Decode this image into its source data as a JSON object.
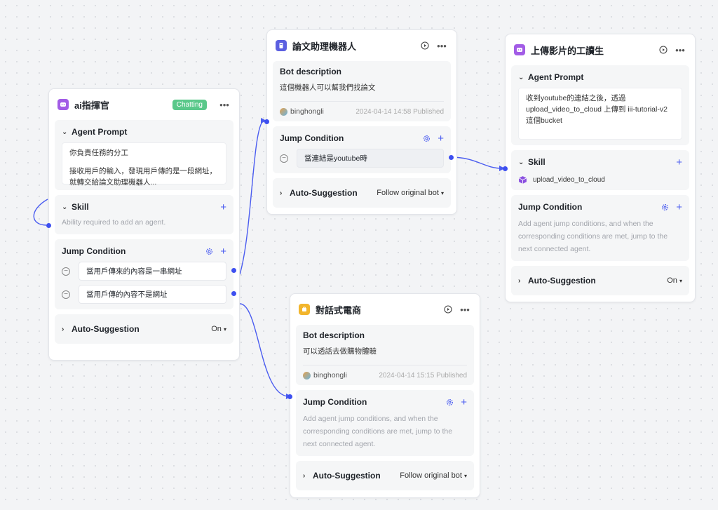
{
  "nodes": {
    "commander": {
      "title": "ai指揮官",
      "badge": "Chatting",
      "icon": "chat-bot-icon",
      "prompt_label": "Agent Prompt",
      "prompt_text_1": "你負責任務的分工",
      "prompt_text_2": "接收用戶的輸入，發現用戶傳的是一段網址，就轉交給論文助理機器人...",
      "skill_label": "Skill",
      "skill_placeholder": "Ability required to add an agent.",
      "jump_label": "Jump Condition",
      "conditions": [
        "當用戶傳來的內容是一串網址",
        "當用戶傳的內容不是網址"
      ],
      "suggest_label": "Auto-Suggestion",
      "suggest_value": "On"
    },
    "paper": {
      "title": "論文助理機器人",
      "icon": "doc-bot-icon",
      "desc_label": "Bot description",
      "desc_text": "這個機器人可以幫我們找論文",
      "author": "binghongli",
      "date": "2024-04-14 14:58",
      "status": "Published",
      "jump_label": "Jump Condition",
      "conditions": [
        "當連結是youtube時"
      ],
      "suggest_label": "Auto-Suggestion",
      "suggest_value": "Follow original bot"
    },
    "uploader": {
      "title": "上傳影片的工讀生",
      "icon": "chat-bot-icon",
      "prompt_label": "Agent Prompt",
      "prompt_text": "收到youtube的連結之後，透過 upload_video_to_cloud 上傳到 iii-tutorial-v2 這個bucket",
      "skill_label": "Skill",
      "skill_item": "upload_video_to_cloud",
      "jump_label": "Jump Condition",
      "jump_placeholder": "Add agent jump conditions, and when the corresponding conditions are met, jump to the next connected agent.",
      "suggest_label": "Auto-Suggestion",
      "suggest_value": "On"
    },
    "ecommerce": {
      "title": "對話式電商",
      "icon": "shop-bot-icon",
      "desc_label": "Bot description",
      "desc_text": "可以透話去做購物體驗",
      "author": "binghongli",
      "date": "2024-04-14 15:15",
      "status": "Published",
      "jump_label": "Jump Condition",
      "jump_placeholder": "Add agent jump conditions, and when the corresponding conditions are met, jump to the next connected agent.",
      "suggest_label": "Auto-Suggestion",
      "suggest_value": "Follow original bot"
    }
  },
  "colors": {
    "accent": "#3d4ff0",
    "badge": "#5ac88a",
    "purple_icon": "#a25ce6",
    "yellow_icon": "#f2b52c",
    "indigo_icon": "#5b5fe0"
  }
}
